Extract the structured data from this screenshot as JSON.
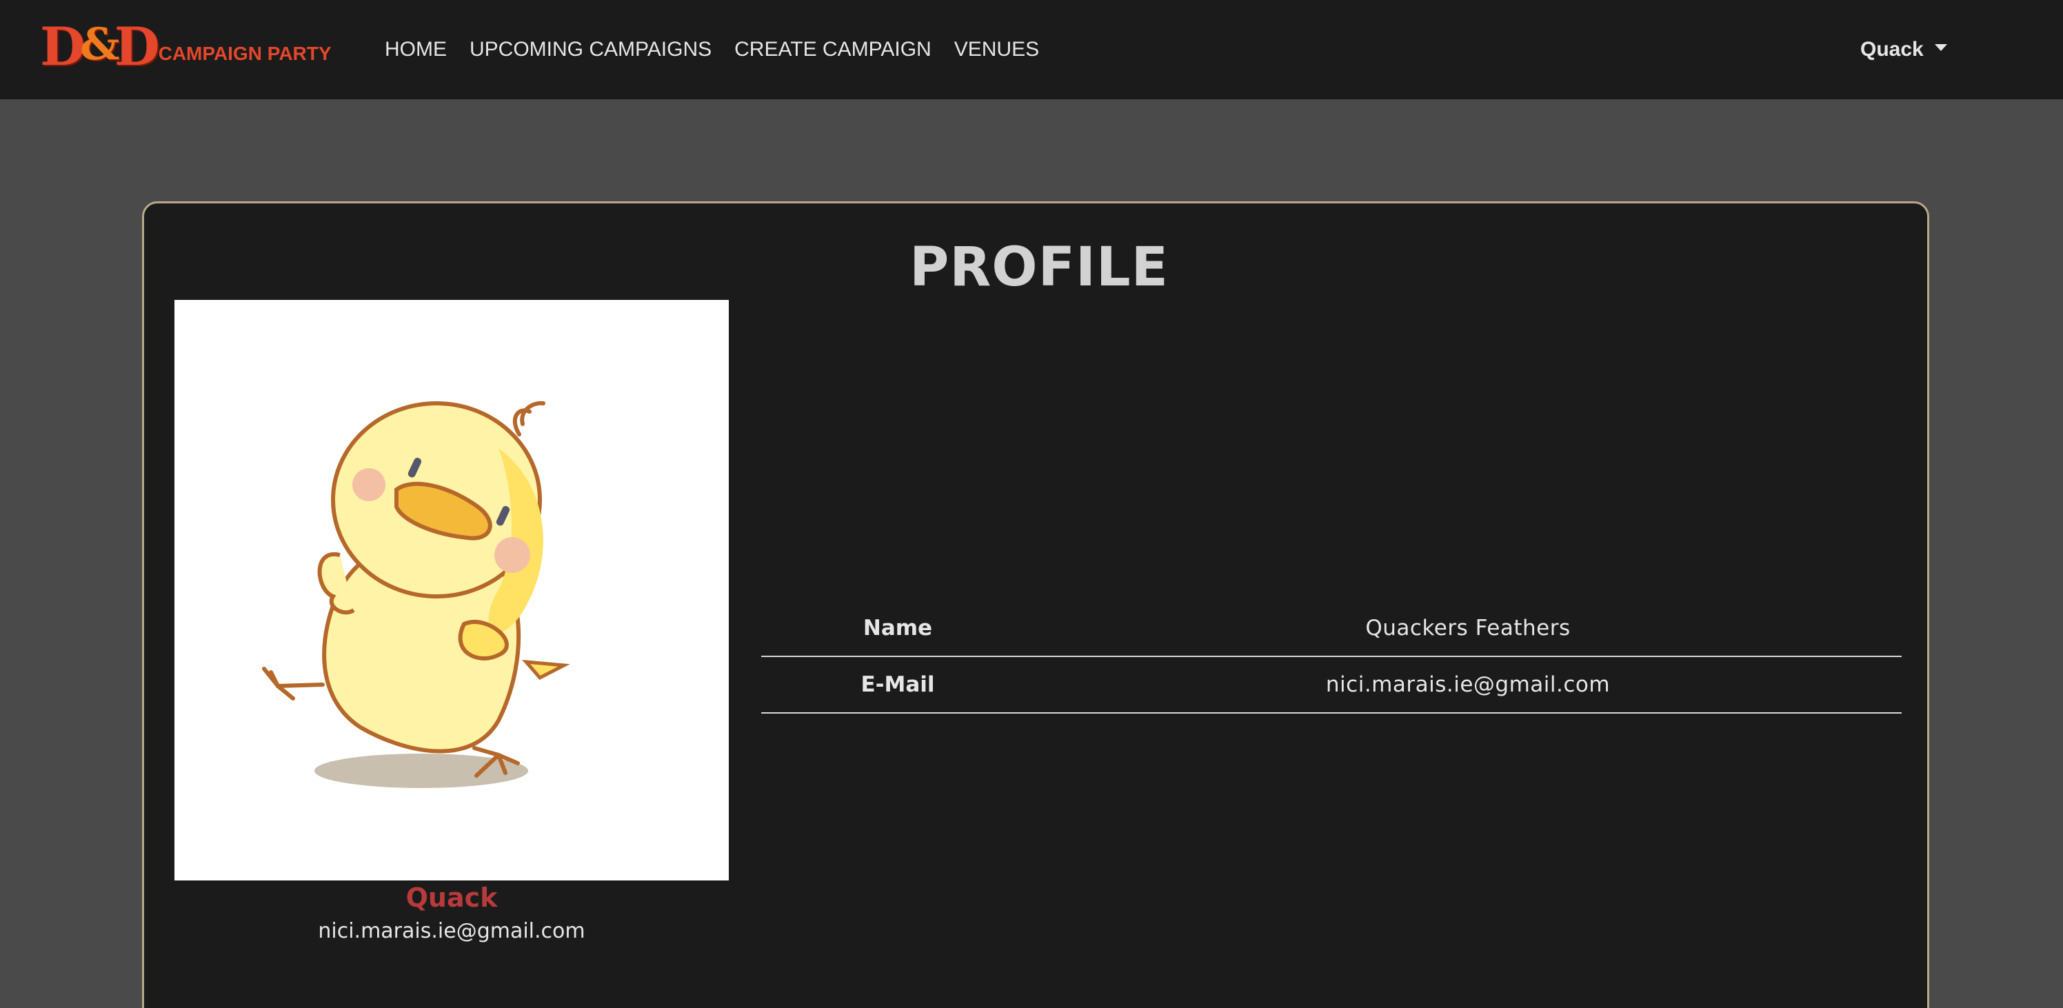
{
  "navbar": {
    "brand": {
      "logo_letters": [
        "D",
        "&",
        "D"
      ],
      "text": "CAMPAIGN PARTY",
      "color": "#e4472b"
    },
    "links": [
      {
        "label": "HOME"
      },
      {
        "label": "UPCOMING CAMPAIGNS"
      },
      {
        "label": "CREATE CAMPAIGN"
      },
      {
        "label": "VENUES"
      }
    ],
    "user_menu": {
      "label": "Quack",
      "icon": "caret-down-icon"
    }
  },
  "profile": {
    "title": "PROFILE",
    "avatar": {
      "icon": "duckling-avatar-image"
    },
    "username": "Quack",
    "email": "nici.marais.ie@gmail.com",
    "details": [
      {
        "label": "Name",
        "value": "Quackers Feathers"
      },
      {
        "label": "E-Mail",
        "value": "nici.marais.ie@gmail.com"
      }
    ]
  },
  "colors": {
    "page_bg": "#4a4a4a",
    "panel_bg": "#1b1b1b",
    "card_border": "#b7a98a",
    "accent_red": "#b83a3a"
  }
}
